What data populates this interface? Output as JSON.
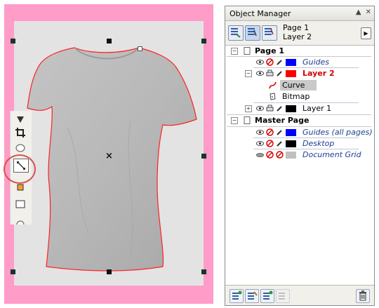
{
  "canvas": {
    "page_color": "#e3e3e3",
    "border_color": "#ff9cc8",
    "object": "t-shirt-bitmap",
    "selection_outline_color": "#ff2020",
    "highlight_color": "#d9534f"
  },
  "toolbox": {
    "tools": [
      "zoom-tool-icon",
      "crop-tool-icon",
      "ellipse-tool-icon",
      "connector-tool-icon",
      "fill-tool-icon",
      "rectangle-tool-icon",
      "shape-tool-icon"
    ]
  },
  "object_manager": {
    "title": "Object Manager",
    "page_info_line1": "Page 1",
    "page_info_line2": "Layer 2",
    "tree": {
      "page1_label": "Page 1",
      "guides_label": "Guides",
      "layer2_label": "Layer 2",
      "curve_label": "Curve",
      "bitmap_label": "Bitmap",
      "layer1_label": "Layer 1",
      "master_page_label": "Master Page",
      "guides_all_label": "Guides (all pages)",
      "desktop_label": "Desktop",
      "document_grid_label": "Document Grid"
    },
    "colors": {
      "guides": "#0000ff",
      "layer2": "#ff0000",
      "layer1": "#000000",
      "guides_all": "#0000ff",
      "desktop": "#000000",
      "document_grid": "#c0c0c0",
      "italic_text": "#1f3f8f"
    }
  }
}
